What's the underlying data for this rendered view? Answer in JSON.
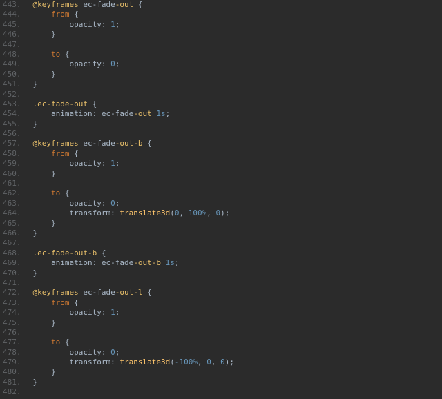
{
  "startLine": 443,
  "lines": [
    {
      "indent": 0,
      "tokens": [
        [
          "at",
          "@keyframes"
        ],
        [
          "sp",
          " "
        ],
        [
          "id",
          "ec-fade"
        ],
        [
          "out",
          "-out"
        ],
        [
          "sp",
          " "
        ],
        [
          "punc",
          "{"
        ]
      ]
    },
    {
      "indent": 1,
      "tokens": [
        [
          "sel",
          "from"
        ],
        [
          "sp",
          " "
        ],
        [
          "punc",
          "{"
        ]
      ]
    },
    {
      "indent": 2,
      "tokens": [
        [
          "prop",
          "opacity"
        ],
        [
          "punc",
          ":"
        ],
        [
          "sp",
          " "
        ],
        [
          "num",
          "1"
        ],
        [
          "punc",
          ";"
        ]
      ]
    },
    {
      "indent": 1,
      "tokens": [
        [
          "punc",
          "}"
        ]
      ]
    },
    {
      "indent": 0,
      "tokens": []
    },
    {
      "indent": 1,
      "tokens": [
        [
          "sel",
          "to"
        ],
        [
          "sp",
          " "
        ],
        [
          "punc",
          "{"
        ]
      ]
    },
    {
      "indent": 2,
      "tokens": [
        [
          "prop",
          "opacity"
        ],
        [
          "punc",
          ":"
        ],
        [
          "sp",
          " "
        ],
        [
          "num",
          "0"
        ],
        [
          "punc",
          ";"
        ]
      ]
    },
    {
      "indent": 1,
      "tokens": [
        [
          "punc",
          "}"
        ]
      ]
    },
    {
      "indent": 0,
      "tokens": [
        [
          "punc",
          "}"
        ]
      ]
    },
    {
      "indent": 0,
      "tokens": []
    },
    {
      "indent": 0,
      "tokens": [
        [
          "class",
          ".ec-fade"
        ],
        [
          "out",
          "-out"
        ],
        [
          "sp",
          " "
        ],
        [
          "punc",
          "{"
        ]
      ]
    },
    {
      "indent": 1,
      "tokens": [
        [
          "prop",
          "animation"
        ],
        [
          "punc",
          ":"
        ],
        [
          "sp",
          " "
        ],
        [
          "anim",
          "ec-fade"
        ],
        [
          "out",
          "-out"
        ],
        [
          "sp",
          " "
        ],
        [
          "dur",
          "1s"
        ],
        [
          "punc",
          ";"
        ]
      ]
    },
    {
      "indent": 0,
      "tokens": [
        [
          "punc",
          "}"
        ]
      ]
    },
    {
      "indent": 0,
      "tokens": []
    },
    {
      "indent": 0,
      "tokens": [
        [
          "at",
          "@keyframes"
        ],
        [
          "sp",
          " "
        ],
        [
          "id",
          "ec-fade"
        ],
        [
          "out",
          "-out-b"
        ],
        [
          "sp",
          " "
        ],
        [
          "punc",
          "{"
        ]
      ]
    },
    {
      "indent": 1,
      "tokens": [
        [
          "sel",
          "from"
        ],
        [
          "sp",
          " "
        ],
        [
          "punc",
          "{"
        ]
      ]
    },
    {
      "indent": 2,
      "tokens": [
        [
          "prop",
          "opacity"
        ],
        [
          "punc",
          ":"
        ],
        [
          "sp",
          " "
        ],
        [
          "num",
          "1"
        ],
        [
          "punc",
          ";"
        ]
      ]
    },
    {
      "indent": 1,
      "tokens": [
        [
          "punc",
          "}"
        ]
      ]
    },
    {
      "indent": 0,
      "tokens": []
    },
    {
      "indent": 1,
      "tokens": [
        [
          "sel",
          "to"
        ],
        [
          "sp",
          " "
        ],
        [
          "punc",
          "{"
        ]
      ]
    },
    {
      "indent": 2,
      "tokens": [
        [
          "prop",
          "opacity"
        ],
        [
          "punc",
          ":"
        ],
        [
          "sp",
          " "
        ],
        [
          "num",
          "0"
        ],
        [
          "punc",
          ";"
        ]
      ]
    },
    {
      "indent": 2,
      "tokens": [
        [
          "prop",
          "transform"
        ],
        [
          "punc",
          ":"
        ],
        [
          "sp",
          " "
        ],
        [
          "func",
          "translate3d"
        ],
        [
          "punc",
          "("
        ],
        [
          "num",
          "0"
        ],
        [
          "punc",
          ","
        ],
        [
          "sp",
          " "
        ],
        [
          "num",
          "100%"
        ],
        [
          "punc",
          ","
        ],
        [
          "sp",
          " "
        ],
        [
          "num",
          "0"
        ],
        [
          "punc",
          ")"
        ],
        [
          "punc",
          ";"
        ]
      ]
    },
    {
      "indent": 1,
      "tokens": [
        [
          "punc",
          "}"
        ]
      ]
    },
    {
      "indent": 0,
      "tokens": [
        [
          "punc",
          "}"
        ]
      ]
    },
    {
      "indent": 0,
      "tokens": []
    },
    {
      "indent": 0,
      "tokens": [
        [
          "class",
          ".ec-fade"
        ],
        [
          "out",
          "-out-b"
        ],
        [
          "sp",
          " "
        ],
        [
          "punc",
          "{"
        ]
      ]
    },
    {
      "indent": 1,
      "tokens": [
        [
          "prop",
          "animation"
        ],
        [
          "punc",
          ":"
        ],
        [
          "sp",
          " "
        ],
        [
          "anim",
          "ec-fade"
        ],
        [
          "out",
          "-out-b"
        ],
        [
          "sp",
          " "
        ],
        [
          "dur",
          "1s"
        ],
        [
          "punc",
          ";"
        ]
      ]
    },
    {
      "indent": 0,
      "tokens": [
        [
          "punc",
          "}"
        ]
      ]
    },
    {
      "indent": 0,
      "tokens": []
    },
    {
      "indent": 0,
      "tokens": [
        [
          "at",
          "@keyframes"
        ],
        [
          "sp",
          " "
        ],
        [
          "id",
          "ec-fade"
        ],
        [
          "out",
          "-out-l"
        ],
        [
          "sp",
          " "
        ],
        [
          "punc",
          "{"
        ]
      ]
    },
    {
      "indent": 1,
      "tokens": [
        [
          "sel",
          "from"
        ],
        [
          "sp",
          " "
        ],
        [
          "punc",
          "{"
        ]
      ]
    },
    {
      "indent": 2,
      "tokens": [
        [
          "prop",
          "opacity"
        ],
        [
          "punc",
          ":"
        ],
        [
          "sp",
          " "
        ],
        [
          "num",
          "1"
        ],
        [
          "punc",
          ";"
        ]
      ]
    },
    {
      "indent": 1,
      "tokens": [
        [
          "punc",
          "}"
        ]
      ]
    },
    {
      "indent": 0,
      "tokens": []
    },
    {
      "indent": 1,
      "tokens": [
        [
          "sel",
          "to"
        ],
        [
          "sp",
          " "
        ],
        [
          "punc",
          "{"
        ]
      ]
    },
    {
      "indent": 2,
      "tokens": [
        [
          "prop",
          "opacity"
        ],
        [
          "punc",
          ":"
        ],
        [
          "sp",
          " "
        ],
        [
          "num",
          "0"
        ],
        [
          "punc",
          ";"
        ]
      ]
    },
    {
      "indent": 2,
      "tokens": [
        [
          "prop",
          "transform"
        ],
        [
          "punc",
          ":"
        ],
        [
          "sp",
          " "
        ],
        [
          "func",
          "translate3d"
        ],
        [
          "punc",
          "("
        ],
        [
          "num",
          "-100%"
        ],
        [
          "punc",
          ","
        ],
        [
          "sp",
          " "
        ],
        [
          "num",
          "0"
        ],
        [
          "punc",
          ","
        ],
        [
          "sp",
          " "
        ],
        [
          "num",
          "0"
        ],
        [
          "punc",
          ")"
        ],
        [
          "punc",
          ";"
        ]
      ]
    },
    {
      "indent": 1,
      "tokens": [
        [
          "punc",
          "}"
        ]
      ]
    },
    {
      "indent": 0,
      "tokens": [
        [
          "punc",
          "}"
        ]
      ]
    },
    {
      "indent": 0,
      "tokens": []
    }
  ]
}
